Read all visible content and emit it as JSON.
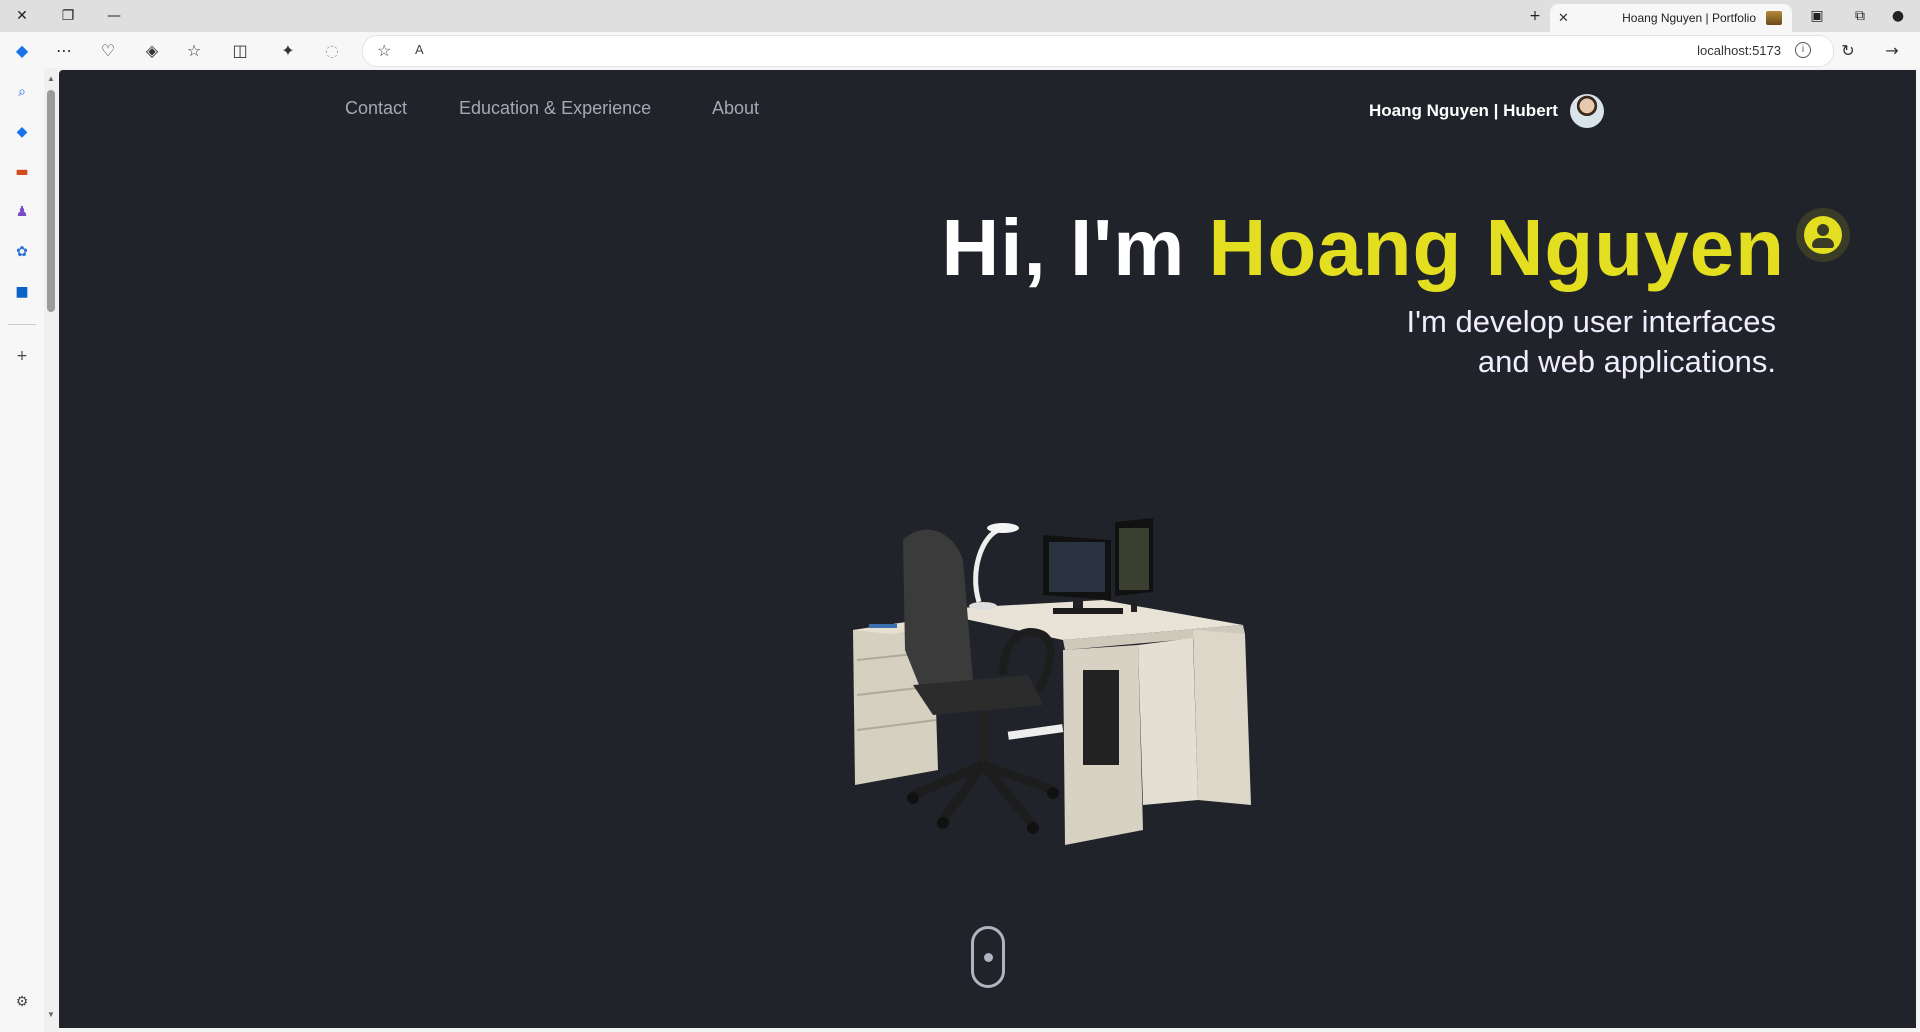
{
  "browser": {
    "tab_title": "Hoang Nguyen | Portfolio",
    "url": "localhost:5173",
    "close_label": "✕",
    "new_tab_label": "+"
  },
  "nav": {
    "brand": "Hoang Nguyen | Hubert",
    "links": [
      "About",
      "Education & Experience",
      "Contact"
    ]
  },
  "hero": {
    "title_prefix": "Hi, I'm ",
    "title_name": "Hoang Nguyen",
    "subtitle_line1": "I'm develop user interfaces",
    "subtitle_line2": "and web applications."
  },
  "colors": {
    "background": "#202329",
    "accent": "#e3de20",
    "nav_text": "#a4a8b4",
    "subtitle": "#f1ecff"
  },
  "icons": {
    "hero": "user-circle-icon",
    "scroll": "scroll-mouse-icon"
  }
}
